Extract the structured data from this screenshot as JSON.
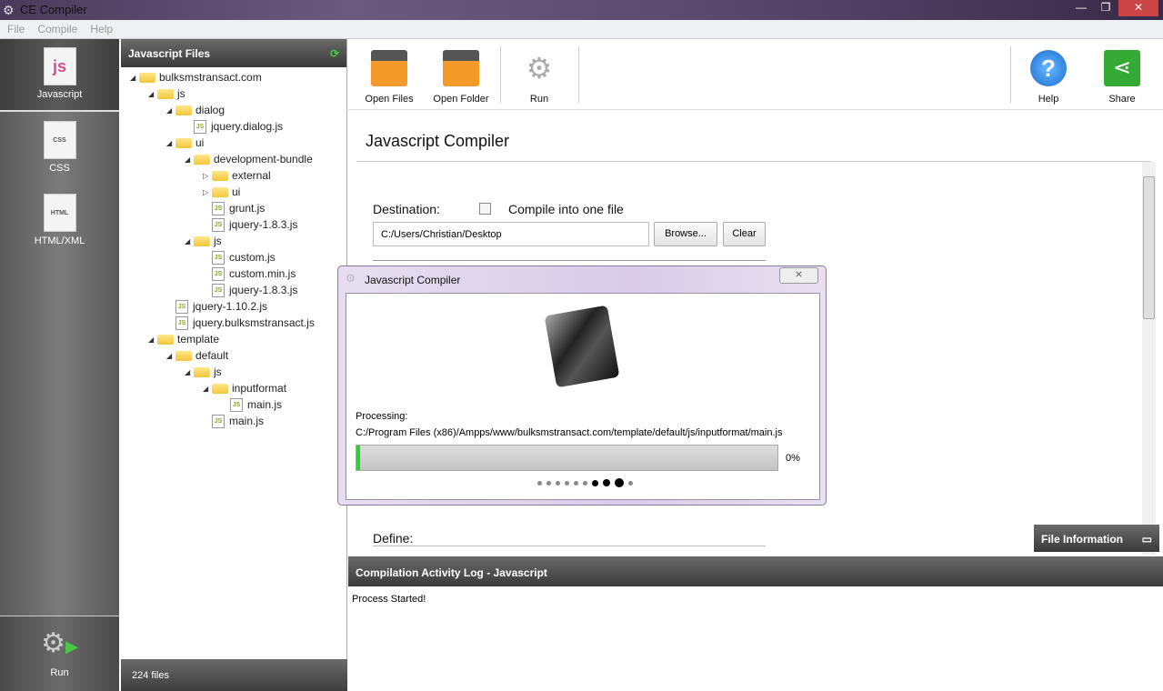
{
  "window": {
    "title": "CE Compiler",
    "min": "—",
    "max": "❐",
    "close": "✕"
  },
  "menu": [
    "File",
    "Compile",
    "Help"
  ],
  "sidebar": {
    "items": [
      {
        "label": "Javascript",
        "icon": "js-file-icon",
        "badge": "js"
      },
      {
        "label": "CSS",
        "icon": "css-file-icon",
        "badge": "CSS"
      },
      {
        "label": "HTML/XML",
        "icon": "html-file-icon",
        "badge": "HTML"
      }
    ],
    "run": "Run"
  },
  "files": {
    "title": "Javascript Files",
    "footer": "224 files",
    "tree": [
      {
        "label": "bulksmstransact.com",
        "depth": 0,
        "type": "folder",
        "exp": "open"
      },
      {
        "label": "js",
        "depth": 1,
        "type": "folder",
        "exp": "open"
      },
      {
        "label": "dialog",
        "depth": 2,
        "type": "folder",
        "exp": "open"
      },
      {
        "label": "jquery.dialog.js",
        "depth": 3,
        "type": "file"
      },
      {
        "label": "ui",
        "depth": 2,
        "type": "folder",
        "exp": "open"
      },
      {
        "label": "development-bundle",
        "depth": 3,
        "type": "folder",
        "exp": "open"
      },
      {
        "label": "external",
        "depth": 4,
        "type": "folder",
        "exp": "closed"
      },
      {
        "label": "ui",
        "depth": 4,
        "type": "folder",
        "exp": "closed"
      },
      {
        "label": "grunt.js",
        "depth": 4,
        "type": "file"
      },
      {
        "label": "jquery-1.8.3.js",
        "depth": 4,
        "type": "file"
      },
      {
        "label": "js",
        "depth": 3,
        "type": "folder",
        "exp": "open"
      },
      {
        "label": "custom.js",
        "depth": 4,
        "type": "file"
      },
      {
        "label": "custom.min.js",
        "depth": 4,
        "type": "file"
      },
      {
        "label": "jquery-1.8.3.js",
        "depth": 4,
        "type": "file"
      },
      {
        "label": "jquery-1.10.2.js",
        "depth": 2,
        "type": "file"
      },
      {
        "label": "jquery.bulksmstransact.js",
        "depth": 2,
        "type": "file"
      },
      {
        "label": "template",
        "depth": 1,
        "type": "folder",
        "exp": "open"
      },
      {
        "label": "default",
        "depth": 2,
        "type": "folder",
        "exp": "open"
      },
      {
        "label": "js",
        "depth": 3,
        "type": "folder",
        "exp": "open"
      },
      {
        "label": "inputformat",
        "depth": 4,
        "type": "folder",
        "exp": "open"
      },
      {
        "label": "main.js",
        "depth": 5,
        "type": "file"
      },
      {
        "label": "main.js",
        "depth": 4,
        "type": "file"
      }
    ]
  },
  "toolbar": {
    "open_files": "Open Files",
    "open_folder": "Open Folder",
    "run": "Run",
    "help": "Help",
    "share": "Share"
  },
  "main": {
    "title": "Javascript Compiler",
    "destination_label": "Destination:",
    "compile_one": "Compile into one file",
    "compile_one_checked": false,
    "destination_value": "C:/Users/Christian/Desktop",
    "browse": "Browse...",
    "clear": "Clear",
    "define_label": "Define:",
    "file_info": "File Information"
  },
  "log": {
    "title": "Compilation Activity Log - Javascript",
    "text": "Process Started!"
  },
  "dialog": {
    "title": "Javascript Compiler",
    "close": "⨯",
    "processing": "Processing:",
    "path": "C:/Program Files (x86)/Ampps/www/bulksmstransact.com/template/default/js/inputformat/main.js",
    "progress_percent": 0,
    "progress_label": "0%"
  },
  "colors": {
    "progress": "#33cc33",
    "panel_header": "#4a4a4a"
  }
}
